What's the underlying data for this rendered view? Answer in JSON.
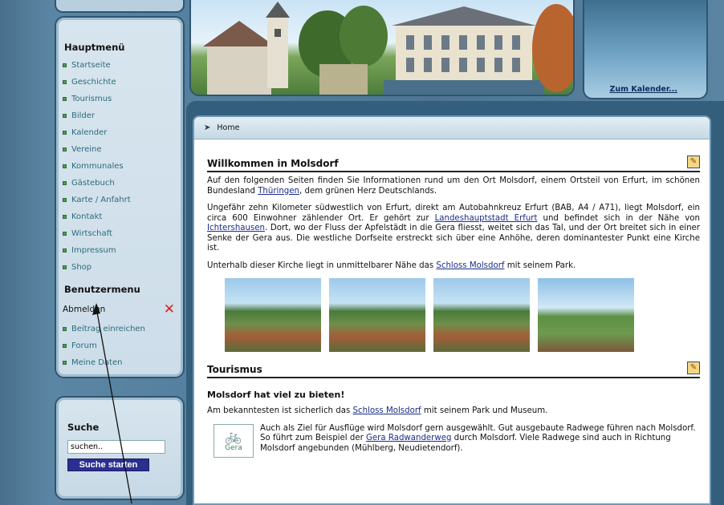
{
  "sidebar": {
    "main_menu_title": "Hauptmenü",
    "main_menu": [
      "Startseite",
      "Geschichte",
      "Tourismus",
      "Bilder",
      "Kalender",
      "Vereine",
      "Kommunales",
      "Gästebuch",
      "Karte / Anfahrt",
      "Kontakt",
      "Wirtschaft",
      "Impressum",
      "Shop"
    ],
    "user_menu_title": "Benutzermenu",
    "logout_label": "Abmelden",
    "user_menu": [
      "Beitrag einreichen",
      "Forum",
      "Meine Daten"
    ]
  },
  "search": {
    "title": "Suche",
    "placeholder": "suchen..",
    "button_label": "Suche starten"
  },
  "header": {
    "calendar_link": "Zum Kalender..."
  },
  "breadcrumb": {
    "current": "Home"
  },
  "welcome": {
    "title": "Willkommen in Molsdorf",
    "p1_a": "Auf den folgenden Seiten finden Sie Informationen rund um den Ort Molsdorf, einem Ortsteil von Erfurt, im schönen Bundesland ",
    "p1_link": "Thüringen",
    "p1_b": ", dem grünen Herz Deutschlands.",
    "p2_a": "Ungefähr zehn Kilometer südwestlich von Erfurt, direkt am Autobahnkreuz Erfurt (BAB, A4 / A71), liegt Molsdorf, ein circa 600 Einwohner zählender Ort. Er gehört zur ",
    "p2_link1": "Landeshauptstadt Erfurt",
    "p2_b": " und befindet sich in der Nähe von ",
    "p2_link2": "Ichtershausen",
    "p2_c": ". Dort, wo der Fluss der Apfelstädt in die Gera fliesst, weitet sich das Tal, und der Ort breitet sich in einer Senke der Gera aus. Die westliche Dorfseite erstreckt sich über eine Anhöhe, deren dominantester Punkt eine Kirche ist.",
    "p3_a": "Unterhalb dieser Kirche liegt in unmittelbarer Nähe das ",
    "p3_link": "Schloss Molsdorf",
    "p3_b": " mit seinem Park."
  },
  "tourism": {
    "title": "Tourismus",
    "subtitle": "Molsdorf hat viel zu bieten!",
    "p1_a": "Am bekanntesten ist sicherlich das ",
    "p1_link": "Schloss Molsdorf",
    "p1_b": " mit seinem Park und Museum.",
    "bike_logo_label": "Gera",
    "p2_a": "Auch als Ziel für Ausflüge wird Molsdorf gern ausgewählt. Gut ausgebaute Radwege führen nach Molsdorf. So führt zum Beispiel der ",
    "p2_link": "Gera Radwanderweg",
    "p2_b": " durch Molsdorf. Viele Radwege sind auch in Richtung Molsdorf angebunden (Mühlberg, Neudietendorf)."
  },
  "icons": {
    "edit": "edit-icon",
    "logout": "close-icon",
    "breadcrumb": "arrow-icon",
    "bicycle": "bicycle-icon"
  },
  "colors": {
    "link": "#1a2c8a",
    "menu_text": "#2d6b7b",
    "logout_x": "#d4231f",
    "search_button": "#2b2f8f"
  }
}
